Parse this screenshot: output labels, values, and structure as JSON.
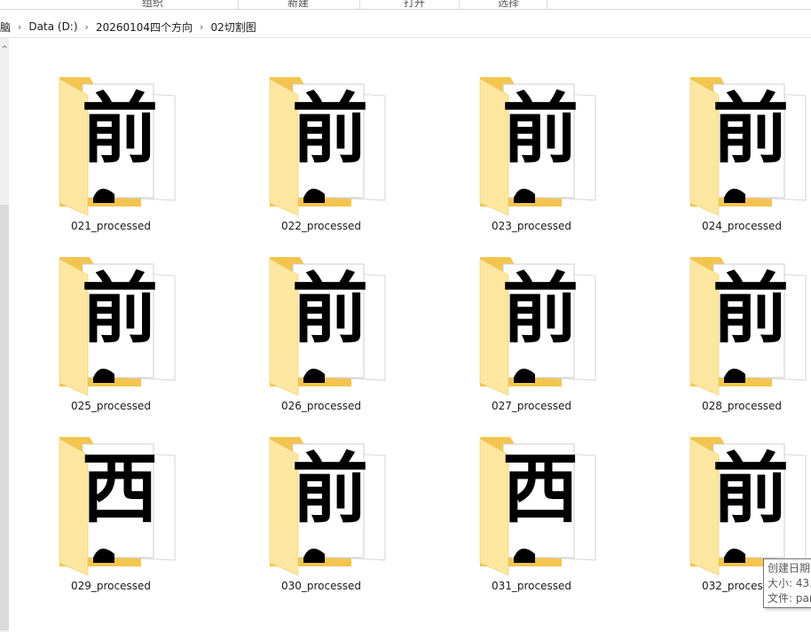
{
  "ribbon": {
    "groups": [
      "组织",
      "新建",
      "打开",
      "选择"
    ]
  },
  "address": {
    "crumbs": [
      "脑",
      "Data (D:)",
      "20260104四个方向",
      "02切割图"
    ]
  },
  "files": [
    {
      "name": "021_processed",
      "glyph": "前"
    },
    {
      "name": "022_processed",
      "glyph": "前"
    },
    {
      "name": "023_processed",
      "glyph": "前"
    },
    {
      "name": "024_processed",
      "glyph": "前"
    },
    {
      "name": "025_processed",
      "glyph": "前"
    },
    {
      "name": "026_processed",
      "glyph": "前"
    },
    {
      "name": "027_processed",
      "glyph": "前"
    },
    {
      "name": "028_processed",
      "glyph": "前"
    },
    {
      "name": "029_processed",
      "glyph": "西"
    },
    {
      "name": "030_processed",
      "glyph": "前"
    },
    {
      "name": "031_processed",
      "glyph": "西"
    },
    {
      "name": "032_processed",
      "glyph": "前"
    }
  ],
  "tooltip": {
    "line1": "创建日期",
    "line2": "大小: 43.",
    "line3": "文件: par"
  },
  "colors": {
    "folder_back": "#f3c54f",
    "folder_front": "#fde7a0",
    "accent": "#0078d7"
  }
}
